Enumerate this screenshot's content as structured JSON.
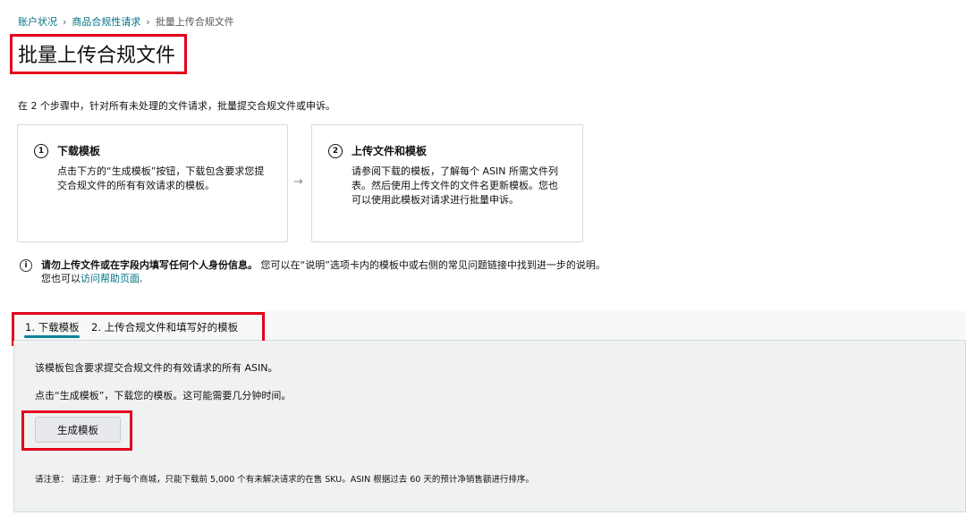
{
  "breadcrumb": {
    "items": [
      "账户状况",
      "商品合规性请求"
    ],
    "current": "批量上传合规文件",
    "separator": "›"
  },
  "page": {
    "title": "批量上传合规文件",
    "intro": "在 2 个步骤中，针对所有未处理的文件请求，批量提交合规文件或申诉。"
  },
  "steps": [
    {
      "number": "1",
      "title": "下载模板",
      "body": "点击下方的“生成模板”按钮，下载包含要求您提交合规文件的所有有效请求的模板。"
    },
    {
      "number": "2",
      "title": "上传文件和模板",
      "body": "请参阅下载的模板，了解每个 ASIN 所需文件列表。然后使用上传文件的文件名更新模板。您也可以使用此模板对请求进行批量申诉。"
    }
  ],
  "arrow": "→",
  "notice": {
    "icon": "i",
    "bold": "请勿上传文件或在字段内填写任何个人身份信息。",
    "text": "您可以在“说明”选项卡内的模板中或右侧的常见问题链接中找到进一步的说明。",
    "line2_prefix": "您也可以",
    "link": "访问帮助页面",
    "line2_suffix": "."
  },
  "tabs": [
    {
      "label": "1. 下载模板",
      "active": true
    },
    {
      "label": "2. 上传合规文件和填写好的模板",
      "active": false
    }
  ],
  "panel": {
    "line1": "该模板包含要求提交合规文件的有效请求的所有 ASIN。",
    "line2": "点击“生成模板”，下载您的模板。这可能需要几分钟时间。",
    "button": "生成模板",
    "note": "请注意： 请注意：对于每个商城，只能下载前 5,000 个有未解决请求的在售 SKU。ASIN 根据过去 60 天的预计净销售额进行排序。"
  },
  "colors": {
    "link": "#007185",
    "tab_underline": "#008296",
    "highlight_box": "#e3001b",
    "panel_bg": "#f0f2f2"
  }
}
